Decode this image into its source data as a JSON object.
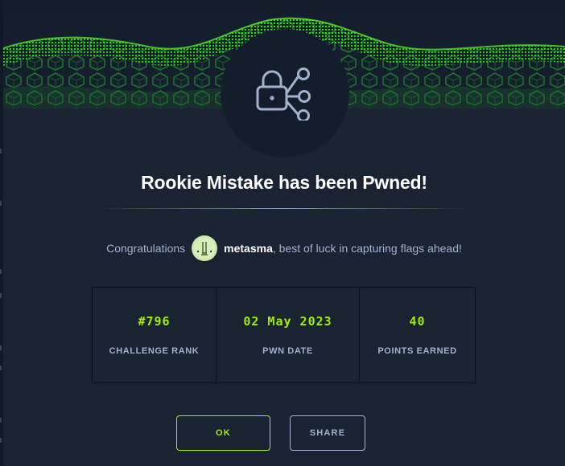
{
  "modal": {
    "title": "Rookie Mistake has been Pwned!",
    "congrats_prefix": "Congratulations",
    "username": "metasma",
    "congrats_suffix": ", best of luck in capturing flags ahead!",
    "badge_icon": "lock-network-icon",
    "accent_color": "#9fef00"
  },
  "stats": [
    {
      "value": "#796",
      "label": "CHALLENGE RANK"
    },
    {
      "value": "02 May 2023",
      "label": "PWN DATE"
    },
    {
      "value": "40",
      "label": "POINTS EARNED"
    }
  ],
  "buttons": {
    "ok": "OK",
    "share": "SHARE"
  }
}
